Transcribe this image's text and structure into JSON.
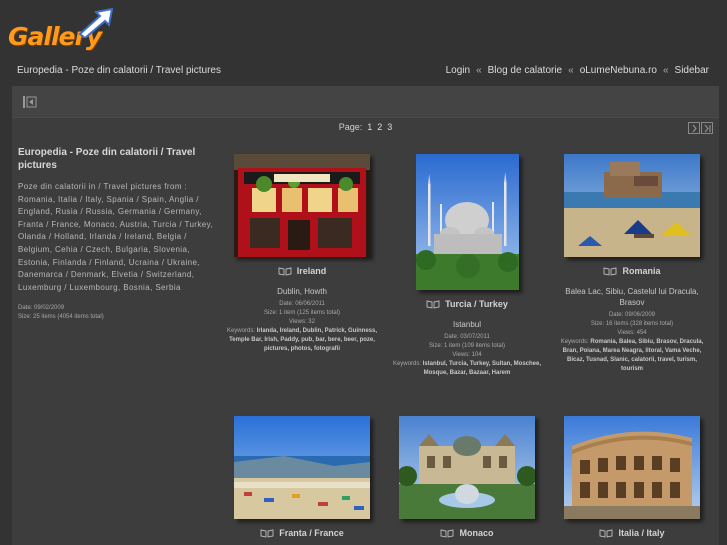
{
  "logo": {
    "text": "Gallery"
  },
  "breadcrumb": {
    "text": "Europedia - Poze din calatorii / Travel pictures"
  },
  "topnav": {
    "items": [
      "Login",
      "Blog de calatorie",
      "oLumeNebuna.ro",
      "Sidebar"
    ],
    "separator": "«"
  },
  "pager": {
    "label": "Page:",
    "pages": [
      "1",
      "2",
      "3"
    ]
  },
  "album": {
    "title": "Europedia - Poze din calatorii / Travel pictures",
    "description": "Poze din calatorii in / Travel pictures from : Romania, Italia / Italy, Spania / Spain, Anglia / England, Rusia / Russia, Germania / Germany, Franta / France, Monaco, Austria, Turcia / Turkey, Olanda / Holland, Irlanda / Ireland, Belgia / Belgium, Cehia / Czech, Bulgaria, Slovenia, Estonia, Finlanda / Finland, Ucraina / Ukraine, Danemarca / Denmark, Elvetia / Switzerland, Luxemburg / Luxembourg, Bosnia, Serbia",
    "date": "Date: 09/02/2009",
    "size": "Size: 25 items (4054 items total)"
  },
  "items": [
    {
      "title": "Ireland",
      "subtitle": "Dublin, Howth",
      "date": "Date: 06/06/2011",
      "size": "Size: 1 item (125 items total)",
      "views": "Views: 32",
      "keywords_label": "Keywords:",
      "keywords": "Irlanda, Ireland, Dublin, Patrick, Guinness, Temple Bar, Irish, Paddy, pub, bar, bere, beer, poze, pictures, photos, fotografii"
    },
    {
      "title": "Turcia / Turkey",
      "subtitle": "Istanbul",
      "date": "Date: 03/07/2011",
      "size": "Size: 1 item (109 items total)",
      "views": "Views: 104",
      "keywords_label": "Keywords:",
      "keywords": "Istanbul, Turcia, Turkey, Sultan, Moschee, Mosque, Bazar, Bazaar, Harem"
    },
    {
      "title": "Romania",
      "subtitle": "Balea Lac, Sibiu, Castelul lui Dracula, Brasov",
      "date": "Date: 09/06/2009",
      "size": "Size: 16 items (328 items total)",
      "views": "Views: 454",
      "keywords_label": "Keywords:",
      "keywords": "Romania, Balea, Sibiu, Brasov, Dracula, Bran, Poiana, Marea Neagra, litoral, Vama Veche, Bicaz, Tusnad, Slanic, calatorii, travel, turism, tourism"
    },
    {
      "title": "Franta / France"
    },
    {
      "title": "Monaco"
    },
    {
      "title": "Italia / Italy"
    }
  ]
}
